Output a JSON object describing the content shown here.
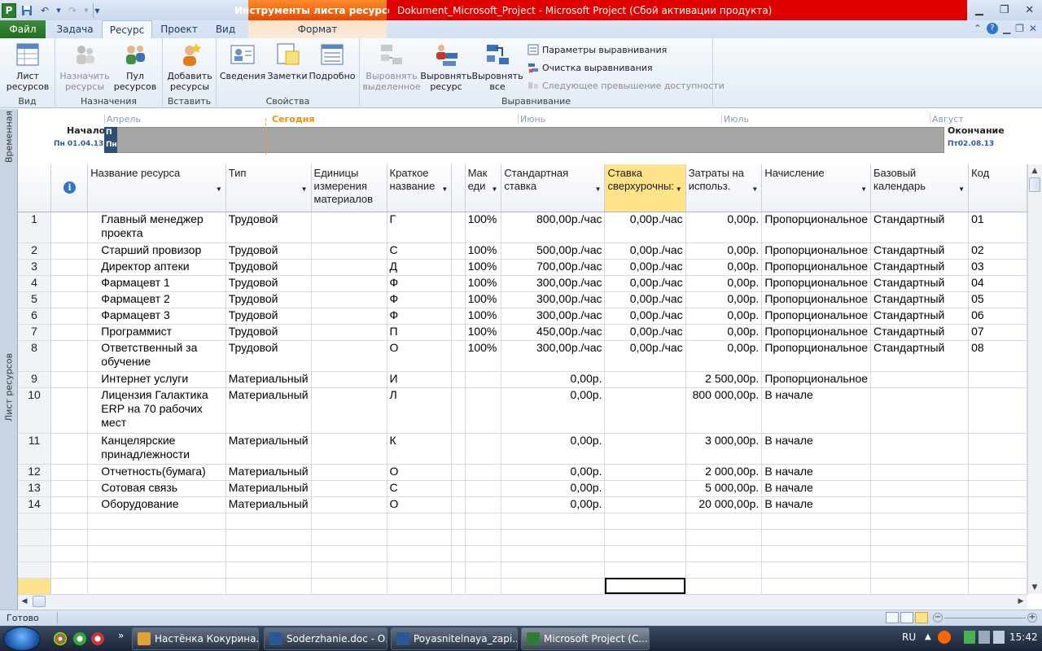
{
  "app": {
    "title": "Dokument_Microsoft_Project  -  Microsoft Project (Сбой активации продукта)",
    "context_group": "Инструменты листа ресурсов",
    "logo_letter": "P"
  },
  "tabs": {
    "file": "Файл",
    "task": "Задача",
    "resource": "Ресурс",
    "project": "Проект",
    "view": "Вид",
    "format": "Формат"
  },
  "ribbon": {
    "view_group": {
      "label": "Вид",
      "sheet_line1": "Лист",
      "sheet_line2": "ресурсов"
    },
    "assign_group": {
      "label": "Назначения",
      "assign_line1": "Назначить",
      "assign_line2": "ресурсы",
      "pool_line1": "Пул",
      "pool_line2": "ресурсов"
    },
    "insert_group": {
      "label": "Вставить",
      "add_line1": "Добавить",
      "add_line2": "ресурсы"
    },
    "props_group": {
      "label": "Свойства",
      "info": "Сведения",
      "notes": "Заметки",
      "details": "Подробно"
    },
    "level_group": {
      "label": "Выравнивание",
      "level_sel_line1": "Выровнять",
      "level_sel_line2": "выделенное",
      "level_res_line1": "Выровнять",
      "level_res_line2": "ресурс",
      "level_all_line1": "Выровнять",
      "level_all_line2": "все",
      "options": "Параметры выравнивания",
      "clear": "Очистка выравнивания",
      "next": "Следующее превышение доступности"
    }
  },
  "timeline": {
    "side_label": "Временная",
    "start_label": "Начало",
    "start_date": "Пн 01.04.13",
    "finish_label": "Окончание",
    "finish_date": "Пт02.08.13",
    "today": "Сегодня",
    "months": [
      "Апрель",
      "Июнь",
      "Июль",
      "Август"
    ],
    "bar_line1": "П",
    "bar_line2": "Пн"
  },
  "sheet": {
    "side_label": "Лист ресурсов",
    "columns": [
      {
        "label": ""
      },
      {
        "label": "Название ресурса"
      },
      {
        "label": "Тип"
      },
      {
        "label": "Единицы измерения материалов"
      },
      {
        "label": "Краткое название"
      },
      {
        "label": ""
      },
      {
        "label": "Мак еди"
      },
      {
        "label": "Стандартная ставка"
      },
      {
        "label": "Ставка сверхурочны:"
      },
      {
        "label": "Затраты на использ."
      },
      {
        "label": "Начисление"
      },
      {
        "label": "Базовый календарь"
      },
      {
        "label": "Код"
      }
    ],
    "rows": [
      {
        "id": "1",
        "name": "Главный менеджер проекта",
        "type": "Трудовой",
        "mat": "",
        "short": "Г",
        "max": "100%",
        "std": "800,00р./час",
        "ovt": "0,00р./час",
        "cost": "0,00р.",
        "accrue": "Пропорциональное",
        "cal": "Стандартный",
        "code": "01"
      },
      {
        "id": "2",
        "name": "Старший провизор",
        "type": "Трудовой",
        "mat": "",
        "short": "С",
        "max": "100%",
        "std": "500,00р./час",
        "ovt": "0,00р./час",
        "cost": "0,00р.",
        "accrue": "Пропорциональное",
        "cal": "Стандартный",
        "code": "02"
      },
      {
        "id": "3",
        "name": "Директор аптеки",
        "type": "Трудовой",
        "mat": "",
        "short": "Д",
        "max": "100%",
        "std": "700,00р./час",
        "ovt": "0,00р./час",
        "cost": "0,00р.",
        "accrue": "Пропорциональное",
        "cal": "Стандартный",
        "code": "03"
      },
      {
        "id": "4",
        "name": "Фармацевт 1",
        "type": "Трудовой",
        "mat": "",
        "short": "Ф",
        "max": "100%",
        "std": "300,00р./час",
        "ovt": "0,00р./час",
        "cost": "0,00р.",
        "accrue": "Пропорциональное",
        "cal": "Стандартный",
        "code": "04"
      },
      {
        "id": "5",
        "name": "Фармацевт 2",
        "type": "Трудовой",
        "mat": "",
        "short": "Ф",
        "max": "100%",
        "std": "300,00р./час",
        "ovt": "0,00р./час",
        "cost": "0,00р.",
        "accrue": "Пропорциональное",
        "cal": "Стандартный",
        "code": "05"
      },
      {
        "id": "6",
        "name": "Фармацевт 3",
        "type": "Трудовой",
        "mat": "",
        "short": "Ф",
        "max": "100%",
        "std": "300,00р./час",
        "ovt": "0,00р./час",
        "cost": "0,00р.",
        "accrue": "Пропорциональное",
        "cal": "Стандартный",
        "code": "06"
      },
      {
        "id": "7",
        "name": "Программист",
        "type": "Трудовой",
        "mat": "",
        "short": "П",
        "max": "100%",
        "std": "450,00р./час",
        "ovt": "0,00р./час",
        "cost": "0,00р.",
        "accrue": "Пропорциональное",
        "cal": "Стандартный",
        "code": "07"
      },
      {
        "id": "8",
        "name": "Ответственный за обучение",
        "type": "Трудовой",
        "mat": "",
        "short": "О",
        "max": "100%",
        "std": "300,00р./час",
        "ovt": "0,00р./час",
        "cost": "0,00р.",
        "accrue": "Пропорциональное",
        "cal": "Стандартный",
        "code": "08"
      },
      {
        "id": "9",
        "name": "Интернет услуги",
        "type": "Материальный",
        "mat": "",
        "short": "И",
        "max": "",
        "std": "0,00р.",
        "ovt": "",
        "cost": "2 500,00р.",
        "accrue": "Пропорциональное",
        "cal": "",
        "code": ""
      },
      {
        "id": "10",
        "name": "Лицензия Галактика ERP на 70 рабочих мест",
        "type": "Материальный",
        "mat": "",
        "short": "Л",
        "max": "",
        "std": "0,00р.",
        "ovt": "",
        "cost": "800 000,00р.",
        "accrue": "В начале",
        "cal": "",
        "code": ""
      },
      {
        "id": "11",
        "name": "Канцелярские принадлежности",
        "type": "Материальный",
        "mat": "",
        "short": "К",
        "max": "",
        "std": "0,00р.",
        "ovt": "",
        "cost": "3 000,00р.",
        "accrue": "В начале",
        "cal": "",
        "code": ""
      },
      {
        "id": "12",
        "name": "Отчетность(бумага)",
        "type": "Материальный",
        "mat": "",
        "short": "О",
        "max": "",
        "std": "0,00р.",
        "ovt": "",
        "cost": "2 000,00р.",
        "accrue": "В начале",
        "cal": "",
        "code": ""
      },
      {
        "id": "13",
        "name": "Сотовая связь",
        "type": "Материальный",
        "mat": "",
        "short": "С",
        "max": "",
        "std": "0,00р.",
        "ovt": "",
        "cost": "5 000,00р.",
        "accrue": "В начале",
        "cal": "",
        "code": ""
      },
      {
        "id": "14",
        "name": "Оборудование",
        "type": "Материальный",
        "mat": "",
        "short": "О",
        "max": "",
        "std": "0,00р.",
        "ovt": "",
        "cost": "20 000,00р.",
        "accrue": "В начале",
        "cal": "",
        "code": ""
      }
    ]
  },
  "status": {
    "ready": "Готово"
  },
  "taskbar": {
    "tasks": [
      {
        "label": "Настёнка Кокурина..."
      },
      {
        "label": "Soderzhanie.doc - О..."
      },
      {
        "label": "Poyasnitelnaya_zapi..."
      },
      {
        "label": "Microsoft Project (С..."
      }
    ],
    "lang": "RU",
    "clock": "15:42"
  }
}
